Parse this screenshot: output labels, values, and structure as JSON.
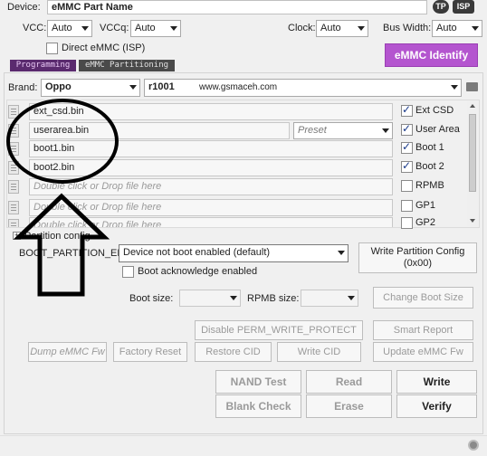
{
  "device": {
    "label": "Device:",
    "value": "eMMC Part Name",
    "tp_badge": "TP",
    "isp_badge": "ISP"
  },
  "power": {
    "vcc_label": "VCC:",
    "vcc_value": "Auto",
    "vccq_label": "VCCq:",
    "vccq_value": "Auto",
    "clock_label": "Clock:",
    "clock_value": "Auto",
    "buswidth_label": "Bus Width:",
    "buswidth_value": "Auto"
  },
  "direct_emmc_label": "Direct eMMC (ISP)",
  "emmc_identify_label": "eMMC Identify",
  "tabs": [
    {
      "label": "Programming"
    },
    {
      "label": "eMMC Partitioning"
    }
  ],
  "brand": {
    "label": "Brand:",
    "value": "Oppo",
    "model": "r1001",
    "url": "www.gsmaceh.com"
  },
  "files": [
    {
      "value": "ext_csd.bin",
      "part": "Ext CSD",
      "checked": true
    },
    {
      "value": "userarea.bin",
      "preset": "Preset",
      "part": "User Area",
      "checked": true
    },
    {
      "value": "boot1.bin",
      "part": "Boot 1",
      "checked": true
    },
    {
      "value": "boot2.bin",
      "part": "Boot 2",
      "checked": true
    },
    {
      "value": "Double click or Drop file here",
      "part": "RPMB",
      "checked": false
    },
    {
      "value": "Double click or Drop file here",
      "part": "GP1",
      "checked": false
    },
    {
      "value": "Double click or Drop file here",
      "part": "GP2",
      "checked": false
    }
  ],
  "partition_config": {
    "label": "Partition config",
    "boot_partition_label": "BOOT_PARTITION_EN",
    "boot_partition_value": "Device not boot enabled (default)",
    "write_config_label_1": "Write Partition Config",
    "write_config_label_2": "(0x00)",
    "boot_ack_label": "Boot acknowledge enabled",
    "boot_size_label": "Boot size:",
    "rpmb_size_label": "RPMB size:",
    "change_boot_size_label": "Change Boot Size"
  },
  "actions": {
    "disable_perm": "Disable PERM_WRITE_PROTECT",
    "smart_report": "Smart Report",
    "dump_emmc_fw": "Dump eMMC Fw",
    "factory_reset": "Factory Reset",
    "restore_cid": "Restore CID",
    "write_cid": "Write CID",
    "update_emmc_fw": "Update eMMC Fw"
  },
  "main_buttons": {
    "nand_test": "NAND Test",
    "read": "Read",
    "write": "Write",
    "blank_check": "Blank Check",
    "erase": "Erase",
    "verify": "Verify"
  },
  "colors": {
    "accent": "#b455cf",
    "tab_active": "#5a2a6e",
    "tab_inactive": "#4a4a4a",
    "annotation": "#000000"
  }
}
